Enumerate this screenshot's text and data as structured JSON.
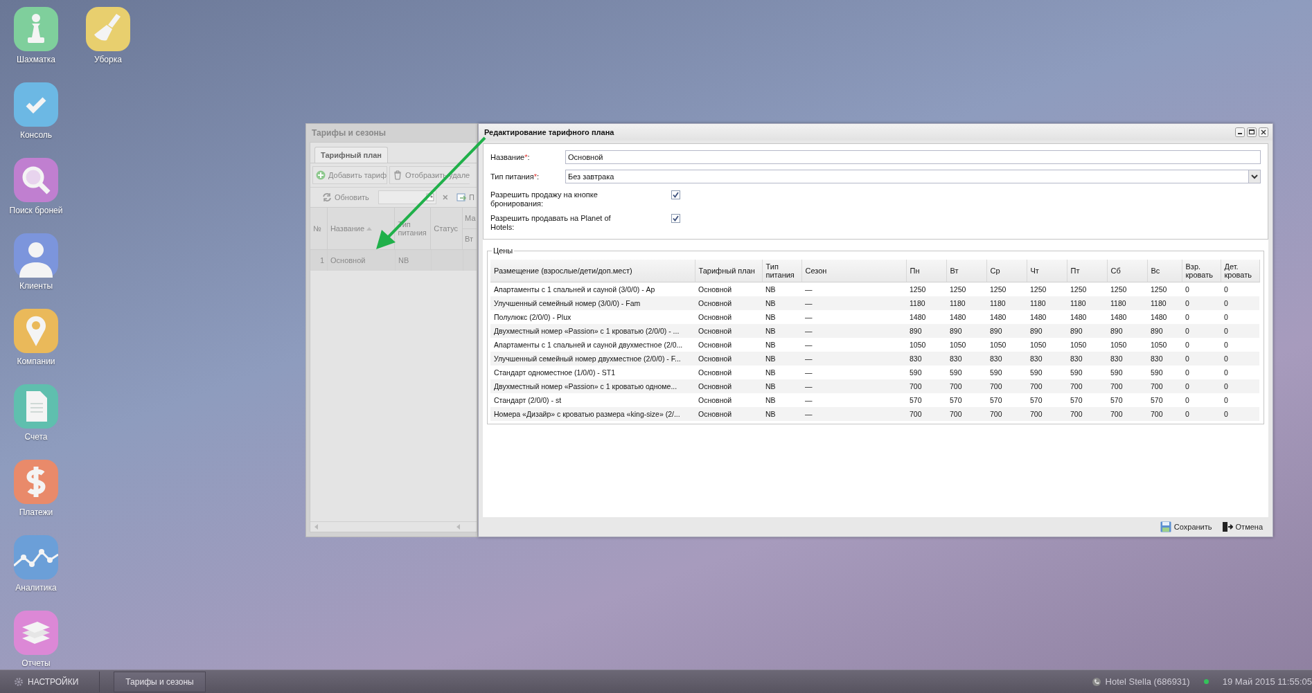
{
  "desktop_icons": {
    "columns": [
      [
        {
          "label": "Шахматка",
          "kind": "chess"
        },
        {
          "label": "Консоль",
          "kind": "check"
        },
        {
          "label": "Поиск броней",
          "kind": "search"
        },
        {
          "label": "Клиенты",
          "kind": "person"
        },
        {
          "label": "Компании",
          "kind": "pin"
        },
        {
          "label": "Счета",
          "kind": "document"
        },
        {
          "label": "Платежи",
          "kind": "dollar"
        },
        {
          "label": "Аналитика",
          "kind": "chart"
        },
        {
          "label": "Отчеты",
          "kind": "books"
        }
      ],
      [
        {
          "label": "Уборка",
          "kind": "broom"
        }
      ]
    ]
  },
  "background_window": {
    "title": "Тарифы и сезоны",
    "tabs": [
      {
        "label": "Тарифный план",
        "selected": true
      }
    ],
    "toolbar": [
      {
        "label": "Добавить тариф",
        "kind": "add"
      },
      {
        "label": "Отобразить удале",
        "kind": "trash"
      }
    ],
    "refresh_button": "Обновить",
    "export_button": "П",
    "columns": [
      "№",
      "Название",
      "Тип питания",
      "Статус"
    ],
    "column_5": {
      "label": "Ма",
      "sub": "Вт"
    },
    "rows": [
      {
        "cells": [
          "1",
          "Основной",
          "NB",
          ""
        ],
        "selected": true
      }
    ]
  },
  "dialog": {
    "title": "Редактирование тарифного плана",
    "fields": [
      {
        "label": "Название",
        "required_mark": "*",
        "colon": ":",
        "kind": "text",
        "value": "Основной"
      },
      {
        "label": "Тип питания",
        "required_mark": "*",
        "colon": ":",
        "kind": "select",
        "value": "Без завтрака"
      }
    ],
    "checkboxes": [
      {
        "label": "Разрешить продажу на кнопке бронирования:",
        "checked": true
      },
      {
        "label": "Разрешить продавать на Planet of Hotels:",
        "checked": true
      }
    ],
    "prices": {
      "legend": "Цены",
      "columns": [
        "Размещение (взрослые/дети/доп.мест)",
        "Тарифный план",
        "Тип питания",
        "Сезон",
        "Пн",
        "Вт",
        "Ср",
        "Чт",
        "Пт",
        "Сб",
        "Вс",
        "Взр. кровать",
        "Дет. кровать"
      ],
      "rows": [
        {
          "cells": [
            "Апартаменты с 1 спальней и сауной (3/0/0) - Ap",
            "Основной",
            "NB",
            "—",
            "1250",
            "1250",
            "1250",
            "1250",
            "1250",
            "1250",
            "1250",
            "0",
            "0"
          ]
        },
        {
          "cells": [
            "Улучшенный семейный номер (3/0/0) - Fam",
            "Основной",
            "NB",
            "—",
            "1180",
            "1180",
            "1180",
            "1180",
            "1180",
            "1180",
            "1180",
            "0",
            "0"
          ]
        },
        {
          "cells": [
            "Полулюкс (2/0/0) - Plux",
            "Основной",
            "NB",
            "—",
            "1480",
            "1480",
            "1480",
            "1480",
            "1480",
            "1480",
            "1480",
            "0",
            "0"
          ]
        },
        {
          "cells": [
            "Двухместный номер «Passion» с 1 кроватью (2/0/0) - ...",
            "Основной",
            "NB",
            "—",
            "890",
            "890",
            "890",
            "890",
            "890",
            "890",
            "890",
            "0",
            "0"
          ]
        },
        {
          "cells": [
            "Апартаменты с 1 спальней и сауной двухместное (2/0...",
            "Основной",
            "NB",
            "—",
            "1050",
            "1050",
            "1050",
            "1050",
            "1050",
            "1050",
            "1050",
            "0",
            "0"
          ]
        },
        {
          "cells": [
            "Улучшенный семейный номер двухместное (2/0/0) - F...",
            "Основной",
            "NB",
            "—",
            "830",
            "830",
            "830",
            "830",
            "830",
            "830",
            "830",
            "0",
            "0"
          ]
        },
        {
          "cells": [
            "Стандарт одноместное (1/0/0) - ST1",
            "Основной",
            "NB",
            "—",
            "590",
            "590",
            "590",
            "590",
            "590",
            "590",
            "590",
            "0",
            "0"
          ]
        },
        {
          "cells": [
            "Двухместный номер «Passion» с 1 кроватью одноме...",
            "Основной",
            "NB",
            "—",
            "700",
            "700",
            "700",
            "700",
            "700",
            "700",
            "700",
            "0",
            "0"
          ]
        },
        {
          "cells": [
            "Стандарт (2/0/0) - st",
            "Основной",
            "NB",
            "—",
            "570",
            "570",
            "570",
            "570",
            "570",
            "570",
            "570",
            "0",
            "0"
          ]
        },
        {
          "cells": [
            "Номера «Дизайр» с кроватью размера «king-size» (2/...",
            "Основной",
            "NB",
            "—",
            "700",
            "700",
            "700",
            "700",
            "700",
            "700",
            "700",
            "0",
            "0"
          ]
        }
      ]
    },
    "buttons": [
      {
        "label": "Сохранить",
        "kind": "save"
      },
      {
        "label": "Отмена",
        "kind": "cancel"
      }
    ]
  },
  "taskbar": {
    "settings_button": "НАСТРОЙКИ",
    "tasks": [
      {
        "label": "Тарифы и сезоны",
        "selected": false
      }
    ],
    "hotel": "Hotel Stella (686931)",
    "online": true,
    "datetime": "19 Май 2015 11:55:05"
  }
}
